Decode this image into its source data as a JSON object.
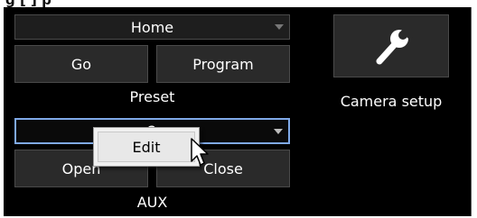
{
  "heading_fragment": "g                          [      ]  p",
  "preset": {
    "selected": "Home",
    "go_label": "Go",
    "program_label": "Program",
    "section_label": "Preset"
  },
  "aux": {
    "selected": "2",
    "open_label": "Open",
    "close_label": "Close",
    "section_label": "AUX"
  },
  "camera_setup": {
    "icon": "wrench-icon",
    "label": "Camera setup"
  },
  "context_menu": {
    "items": [
      {
        "label": "Edit"
      }
    ]
  },
  "colors": {
    "panel_bg": "#000000",
    "button_bg": "#2a2a2a",
    "focus_border": "#7fa9e8",
    "menu_bg": "#f0f0f0"
  }
}
